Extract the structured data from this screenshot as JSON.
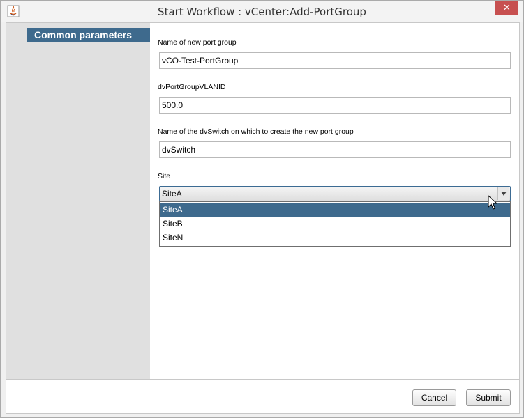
{
  "window": {
    "title": "Start Workflow : vCenter:Add-PortGroup",
    "close_glyph": "✕",
    "icon": "java-app-icon"
  },
  "sidebar": {
    "items": [
      {
        "label": "Common parameters",
        "selected": true
      }
    ]
  },
  "form": {
    "port_group_name": {
      "label": "Name of new port group",
      "value": "vCO-Test-PortGroup"
    },
    "vlan_id": {
      "label": "dvPortGroupVLANID",
      "value": "500.0"
    },
    "dvswitch": {
      "label": "Name of the dvSwitch on which to create the new port group",
      "value": "dvSwitch"
    },
    "site": {
      "label": "Site",
      "value": "SiteA",
      "options": [
        "SiteA",
        "SiteB",
        "SiteN"
      ],
      "dropdown_open": true,
      "highlighted": "SiteA"
    }
  },
  "footer": {
    "cancel_label": "Cancel",
    "submit_label": "Submit"
  },
  "colors": {
    "accent": "#3e6a8d",
    "close": "#c75050",
    "sidebar_bg": "#e0e0e0"
  }
}
